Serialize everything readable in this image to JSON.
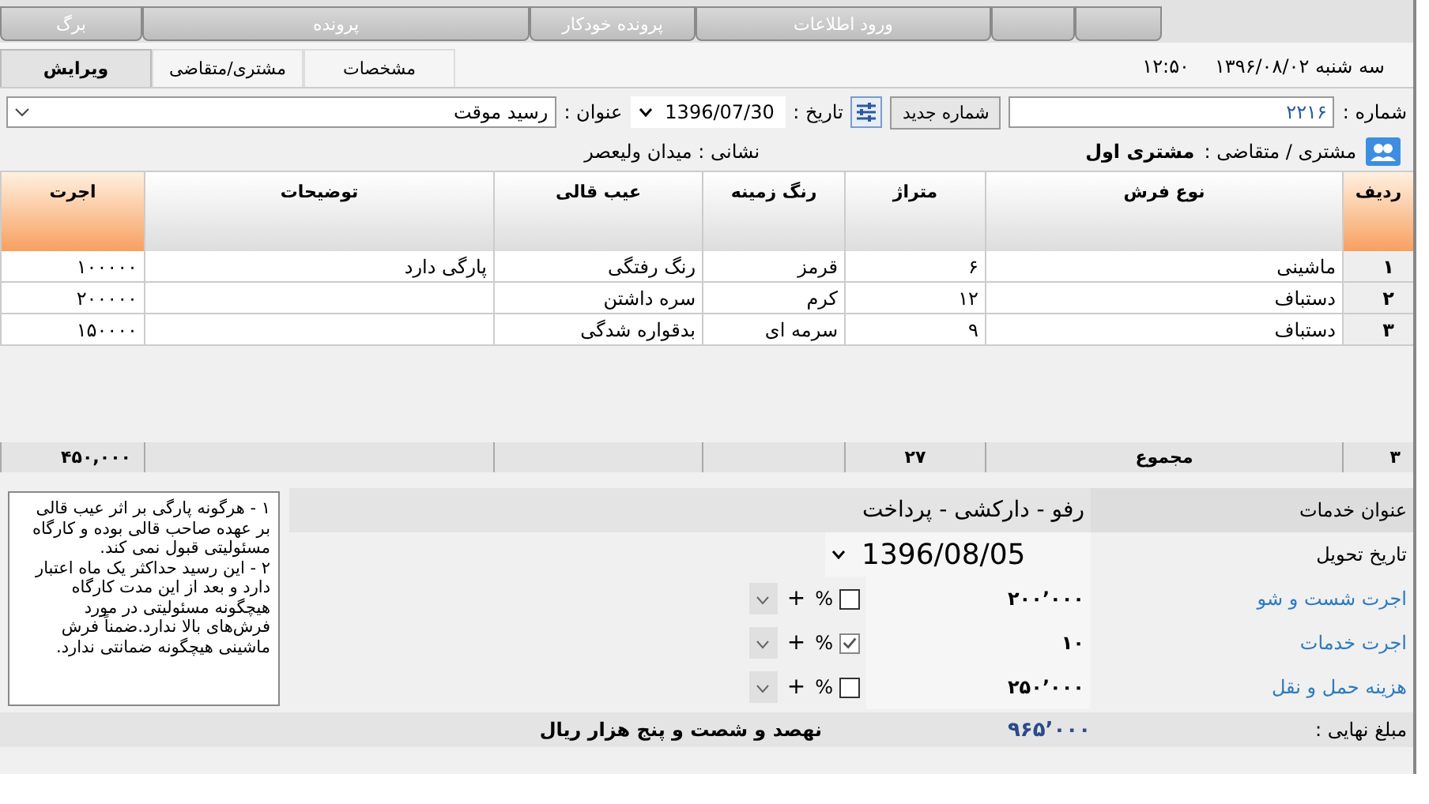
{
  "menu_tabs": [
    {
      "kind": "blank"
    },
    {
      "kind": "blank"
    },
    {
      "kind": "label",
      "label": "ورود اطلاعات"
    },
    {
      "kind": "label",
      "label": "پرونده خودکار"
    },
    {
      "kind": "label",
      "label": "پرونده"
    },
    {
      "kind": "label",
      "label": "برگ"
    }
  ],
  "view_tabs": [
    {
      "label": "مشخصات",
      "selected": false
    },
    {
      "label": "مشتری/متقاضی",
      "selected": false
    },
    {
      "label": "ویرایش",
      "selected": true
    }
  ],
  "clock": {
    "time": "۱۲:۵۰",
    "date": "سه شنبه ۱۳۹۶/۰۸/۰۲"
  },
  "header_form": {
    "number_label": "شماره :",
    "number": "۲۲۱۶",
    "new_number_button": "شماره جدید",
    "date_label": "تاریخ :",
    "date": "1396/07/30",
    "title_label": "عنوان :",
    "title": "رسید موقت"
  },
  "customer": {
    "label": "مشتری / متقاضی :",
    "name": "مشتری اول",
    "address": "نشانی : میدان ولیعصر"
  },
  "table": {
    "columns": [
      {
        "label": "ردیف",
        "highlighted": true
      },
      {
        "label": "نوع فرش",
        "highlighted": false
      },
      {
        "label": "متراژ",
        "highlighted": false
      },
      {
        "label": "رنگ زمینه",
        "highlighted": false
      },
      {
        "label": "عیب قالی",
        "highlighted": false
      },
      {
        "label": "توضیحات",
        "highlighted": false
      },
      {
        "label": "اجرت",
        "highlighted": true
      }
    ],
    "rows": [
      [
        "۱",
        "ماشینی",
        "۶",
        "قرمز",
        "رنگ رفتگی",
        "پارگی  دارد",
        "۱۰۰۰۰۰"
      ],
      [
        "۲",
        "دستباف",
        "۱۲",
        "کرم",
        "سره داشتن",
        null,
        "۲۰۰۰۰۰"
      ],
      [
        "۳",
        "دستباف",
        "۹",
        "سرمه ای",
        "بدقواره شدگی",
        null,
        "۱۵۰۰۰۰"
      ]
    ],
    "totals": {
      "count": "۳",
      "label": "مجموع",
      "area": "۲۷",
      "fee": "۴۵۰,۰۰۰"
    }
  },
  "notes": [
    "۱ - هرگونه پارگی بر اثر عیب قالی بر عهده صاحب قالی بوده و کارگاه مسئولیتی قبول نمی کند.",
    "۲ - این رسید حداکثر یک ماه اعتبار دارد و بعد از این مدت کارگاه هیچگونه مسئولیتی در مورد فرش‌های بالا ندارد.ضمناً فرش ماشینی هیچگونه ضمانتی ندارد."
  ],
  "services": {
    "title_label": "عنوان خدمات",
    "title": "رفو - دارکشی - پرداخت",
    "delivery_label": "تاریخ تحویل",
    "delivery_date": "1396/08/05",
    "charges": [
      {
        "label": "اجرت شست و شو",
        "amount": "۲۰۰٬۰۰۰",
        "percent": false,
        "percent_sign": "%",
        "add": "+"
      },
      {
        "label": "اجرت خدمات",
        "amount": "۱۰",
        "percent": true,
        "percent_sign": "%",
        "add": "+"
      },
      {
        "label": "هزینه حمل و نقل",
        "amount": "۲۵۰٬۰۰۰",
        "percent": false,
        "percent_sign": "%",
        "add": "+"
      }
    ]
  },
  "total": {
    "label": "مبلغ نهایی :",
    "amount": "۹۶۵٬۰۰۰",
    "in_words": "نهصد و شصت و پنج هزار ریال"
  }
}
